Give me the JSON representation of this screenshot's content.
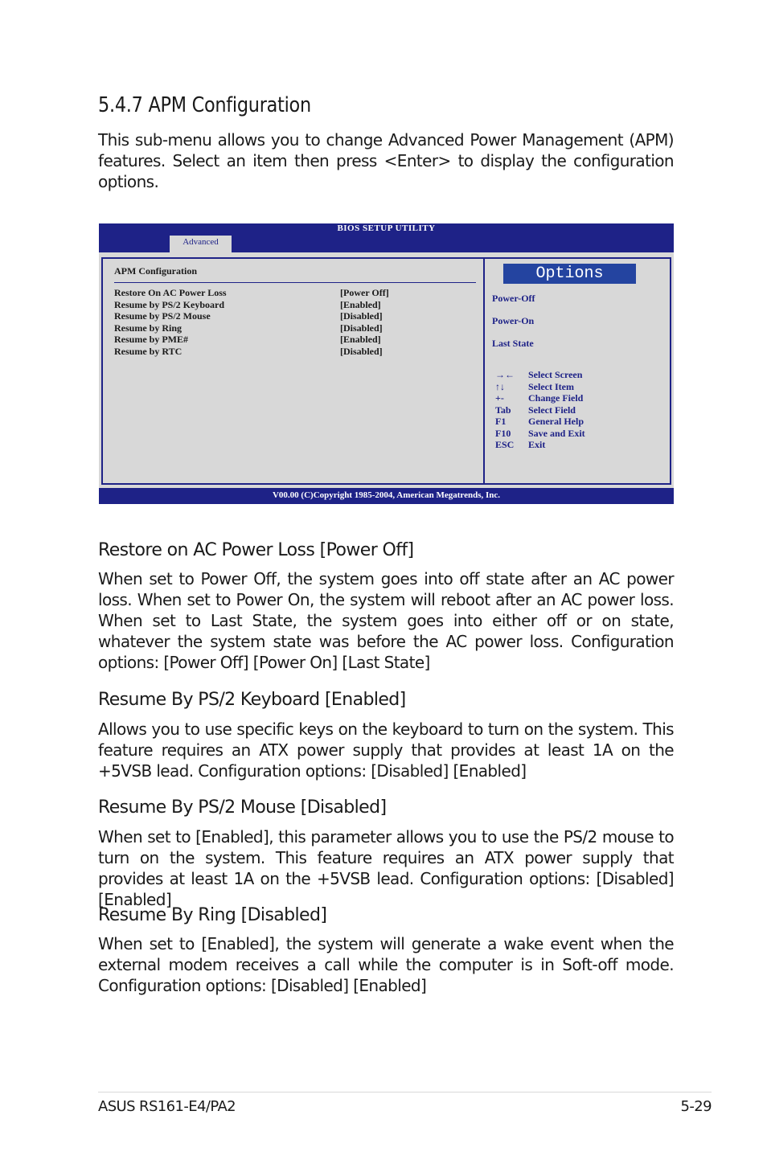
{
  "section": {
    "title": "5.4.7 APM Configuration",
    "intro": "This sub-menu allows you to change Advanced Power Management (APM) features. Select an item then press <Enter> to display the configuration options."
  },
  "bios": {
    "title": "BIOS SETUP UTILITY",
    "active_tab": "Advanced",
    "panel_title": "APM Configuration",
    "items": [
      {
        "label": "Restore On AC Power Loss",
        "value": "[Power Off]"
      },
      {
        "label": "Resume by PS/2 Keyboard",
        "value": "[Enabled]"
      },
      {
        "label": "Resume by PS/2 Mouse",
        "value": "[Disabled]"
      },
      {
        "label": "Resume by Ring",
        "value": "[Disabled]"
      },
      {
        "label": "Resume by PME#",
        "value": "[Enabled]"
      },
      {
        "label": "Resume by RTC",
        "value": "[Disabled]"
      }
    ],
    "options_header": "Options",
    "options": [
      "Power-Off",
      "Power-On",
      "Last State"
    ],
    "keys": [
      {
        "key": "→←",
        "desc": "Select Screen"
      },
      {
        "key": "↑↓",
        "desc": "Select Item"
      },
      {
        "key": "+-",
        "desc": "Change Field"
      },
      {
        "key": "Tab",
        "desc": "Select Field"
      },
      {
        "key": "F1",
        "desc": "General Help"
      },
      {
        "key": "F10",
        "desc": "Save and Exit"
      },
      {
        "key": "ESC",
        "desc": "Exit"
      }
    ],
    "copyright": "V00.00 (C)Copyright 1985-2004, American Megatrends, Inc.",
    "colors": {
      "header_blue": "#1e2287",
      "options_blue": "#2444a0",
      "panel_gray": "#d8d8d8"
    }
  },
  "items": [
    {
      "heading": "Restore on AC Power Loss [Power Off]",
      "body": "When set to Power Off, the system goes into off state after an AC power loss. When set to Power On, the system will reboot after an AC power loss. When set to Last State, the system goes into either off or on state, whatever the system state was before the AC power loss. Configuration options: [Power Off] [Power On] [Last State]"
    },
    {
      "heading": "Resume By PS/2 Keyboard [Enabled]",
      "body": "Allows you to use specific keys on the keyboard to turn on the system. This feature requires an ATX power supply that provides at least 1A on the +5VSB lead. Configuration options: [Disabled] [Enabled]"
    },
    {
      "heading": "Resume By PS/2 Mouse [Disabled]",
      "body": "When set to [Enabled], this parameter allows you to use the PS/2 mouse to turn on the system. This feature requires an ATX power supply that provides at least 1A on the +5VSB lead. Configuration options: [Disabled] [Enabled]"
    },
    {
      "heading": "Resume By Ring [Disabled]",
      "body": "When set to [Enabled], the system will generate a wake event when the external modem receives a call while the computer is in Soft-off mode. Configuration options: [Disabled] [Enabled]"
    }
  ],
  "footer": {
    "product": "ASUS RS161-E4/PA2",
    "page": "5-29"
  }
}
